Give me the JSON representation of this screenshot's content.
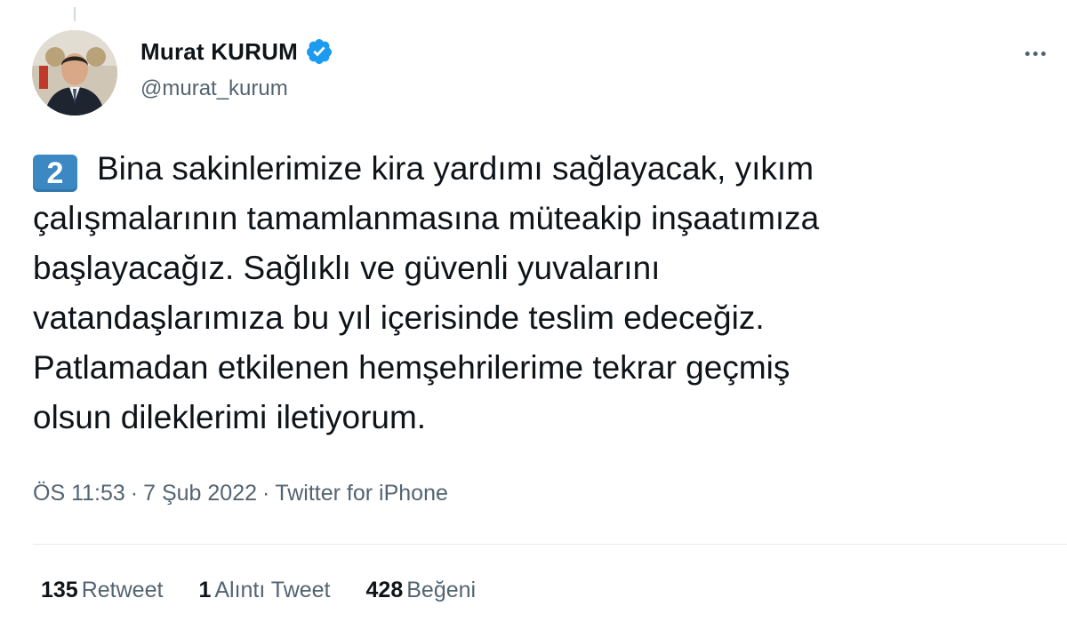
{
  "author": {
    "display_name": "Murat KURUM",
    "handle": "@murat_kurum",
    "verified": true,
    "avatar_icon": "profile-photo"
  },
  "tweet": {
    "thread_number_emoji": "2",
    "text_lines": [
      "Bina sakinlerimize kira yardımı sağlayacak, yıkım",
      "çalışmalarının tamamlanmasına müteakip inşaatımıza",
      "başlayacağız. Sağlıklı ve güvenli yuvalarını",
      "vatandaşlarımıza bu yıl içerisinde teslim edeceğiz.",
      "Patlamadan etkilenen hemşehrilerime tekrar geçmiş",
      "olsun dileklerimi iletiyorum."
    ]
  },
  "meta": {
    "time": "ÖS 11:53",
    "date": "7 Şub 2022",
    "separator": "·",
    "source": "Twitter for iPhone"
  },
  "stats": {
    "retweets": {
      "count": "135",
      "label": "Retweet"
    },
    "quotes": {
      "count": "1",
      "label": "Alıntı Tweet"
    },
    "likes": {
      "count": "428",
      "label": "Beğeni"
    }
  },
  "colors": {
    "text_primary": "#0f1419",
    "text_secondary": "#536471",
    "verified_blue": "#1d9bf0",
    "keycap_blue": "#3b88c3",
    "divider": "#e6ecf0"
  }
}
